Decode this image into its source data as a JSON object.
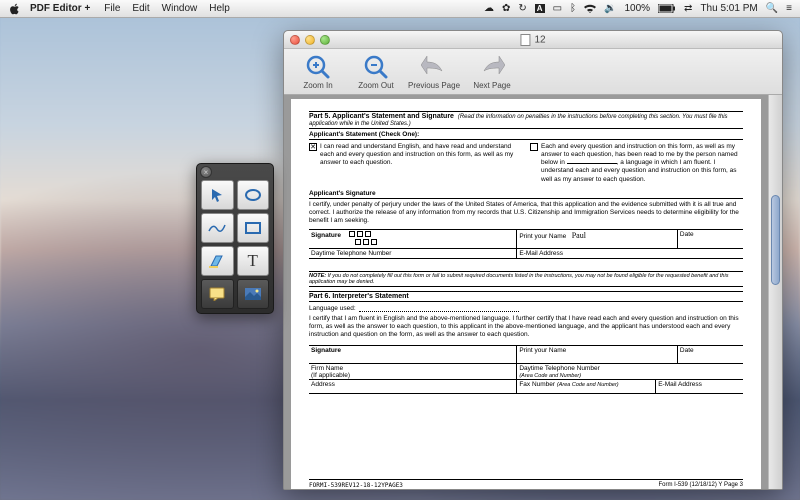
{
  "menubar": {
    "app_name": "PDF Editor +",
    "items": [
      "File",
      "Edit",
      "Window",
      "Help"
    ],
    "battery": "100%",
    "clock": "Thu 5:01 PM"
  },
  "window": {
    "title": "12"
  },
  "toolbar": {
    "zoom_in": "Zoom In",
    "zoom_out": "Zoom Out",
    "prev_page": "Previous Page",
    "next_page": "Next Page"
  },
  "doc": {
    "part5_heading": "Part 5.  Applicant's Statement and Signature",
    "part5_sub": "(Read the information on penalties in the instructions before completing this section. You must file this application while in the United States.)",
    "stmt_title": "Applicant's Statement (Check One):",
    "stmt_a": "I can read and understand English, and have read and understand each and every question and instruction on this form, as well as my answer to each question.",
    "stmt_b_1": "Each and every question and instruction on this form, as well as my answer to each question, has been read to me by the person named below in",
    "stmt_b_2": ", a language in which I am fluent. I understand each and every question and instruction on this form, as well as my answer to each question.",
    "sig_title": "Applicant's Signature",
    "perjury": "I certify, under penalty of perjury under the laws of the United States of America, that this application and the evidence submitted with it is all true and correct.  I authorize the release of any information from my records that U.S. Citizenship and Immigration Services needs to determine eligibility for the benefit I am seeking.",
    "lbl_signature": "Signature",
    "lbl_print_name": "Print your Name",
    "lbl_date": "Date",
    "lbl_daytime": "Daytime Telephone Number",
    "lbl_email": "E-Mail Address",
    "name_value": "Paul",
    "note": "NOTE: If you do not completely fill out this form or fail to submit required documents listed in the instructions, you may not be found eligible for the requested benefit and this application may be denied.",
    "part6_heading": "Part 6.  Interpreter's Statement",
    "lang_used": "Language used:",
    "interp_cert": "I certify that I am fluent in English and the above-mentioned language. I further certify that I have read each and every question and instruction on this form, as well as the answer to each question, to this applicant in the above-mentioned language, and the applicant has understood each and every instruction and question on the form, as well as the answer to each question.",
    "lbl_firm": "Firm Name\n(If applicable)",
    "lbl_firm1": "Firm Name",
    "lbl_firm2": "(If applicable)",
    "lbl_address": "Address",
    "lbl_daytime2": "Daytime Telephone Number",
    "lbl_area": "(Area Code and Number)",
    "lbl_fax": "Fax Number",
    "footer_left": "FORMI-539REV12-18-12YPAGE3",
    "footer_right": "Form I-539 (12/18/12) Y Page 3"
  },
  "palette": {
    "tools": [
      "arrow",
      "ellipse",
      "pencil",
      "rectangle",
      "highlight",
      "text",
      "note",
      "image"
    ]
  }
}
